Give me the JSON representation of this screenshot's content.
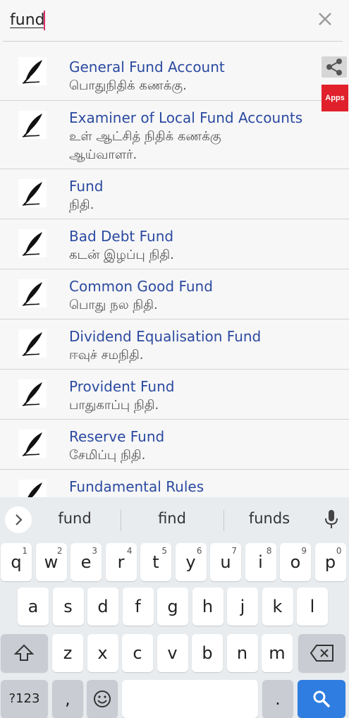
{
  "search": {
    "value": "fund"
  },
  "side_buttons": {
    "apps_label": "Apps"
  },
  "results": [
    {
      "title": "General Fund Account",
      "meaning": "பொதுநிதிக் கணக்கு."
    },
    {
      "title": "Examiner of Local Fund Accounts",
      "meaning": "உள் ஆட்சித் நிதிக் கணக்கு ஆய்வாளர்."
    },
    {
      "title": "Fund",
      "meaning": "நிதி."
    },
    {
      "title": "Bad Debt Fund",
      "meaning": "கடன் இழப்பு நிதி."
    },
    {
      "title": "Common Good Fund",
      "meaning": "பொது நல நிதி."
    },
    {
      "title": "Dividend  Equalisation Fund",
      "meaning": "ஈவுச் சமநிதி."
    },
    {
      "title": "Provident Fund",
      "meaning": "பாதுகாப்பு நிதி."
    },
    {
      "title": "Reserve Fund",
      "meaning": "சேமிப்பு நிதி."
    },
    {
      "title": "Fundamental Rules",
      "meaning": ""
    }
  ],
  "keyboard": {
    "suggestions": [
      "fund",
      "find",
      "funds"
    ],
    "row1": [
      {
        "k": "q",
        "n": "1"
      },
      {
        "k": "w",
        "n": "2"
      },
      {
        "k": "e",
        "n": "3"
      },
      {
        "k": "r",
        "n": "4"
      },
      {
        "k": "t",
        "n": "5"
      },
      {
        "k": "y",
        "n": "6"
      },
      {
        "k": "u",
        "n": "7"
      },
      {
        "k": "i",
        "n": "8"
      },
      {
        "k": "o",
        "n": "9"
      },
      {
        "k": "p",
        "n": "0"
      }
    ],
    "row2": [
      "a",
      "s",
      "d",
      "f",
      "g",
      "h",
      "j",
      "k",
      "l"
    ],
    "row3": [
      "z",
      "x",
      "c",
      "v",
      "b",
      "n",
      "m"
    ],
    "symbols_label": "?123",
    "comma": ",",
    "period": "."
  },
  "colors": {
    "accent": "#2b4aa0",
    "search_key": "#2f7de1",
    "apps": "#e0202a"
  }
}
